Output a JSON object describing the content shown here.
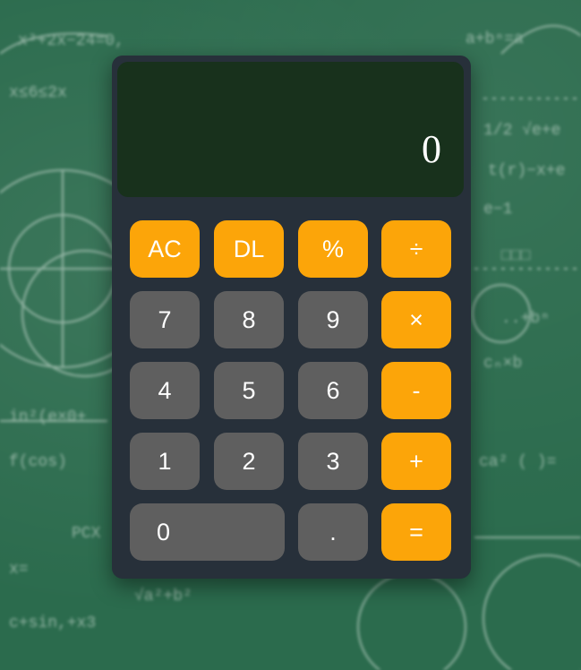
{
  "display": {
    "value": "0"
  },
  "keys": {
    "ac": "AC",
    "dl": "DL",
    "percent": "%",
    "divide": "÷",
    "seven": "7",
    "eight": "8",
    "nine": "9",
    "multiply": "×",
    "four": "4",
    "five": "5",
    "six": "6",
    "minus": "-",
    "one": "1",
    "two": "2",
    "three": "3",
    "plus": "+",
    "zero": "0",
    "dot": ".",
    "equals": "="
  },
  "colors": {
    "operator": "#fca509",
    "number": "#5f5f5f",
    "body": "#27303a",
    "display": "#18311c",
    "background": "#2b6b4d"
  }
}
